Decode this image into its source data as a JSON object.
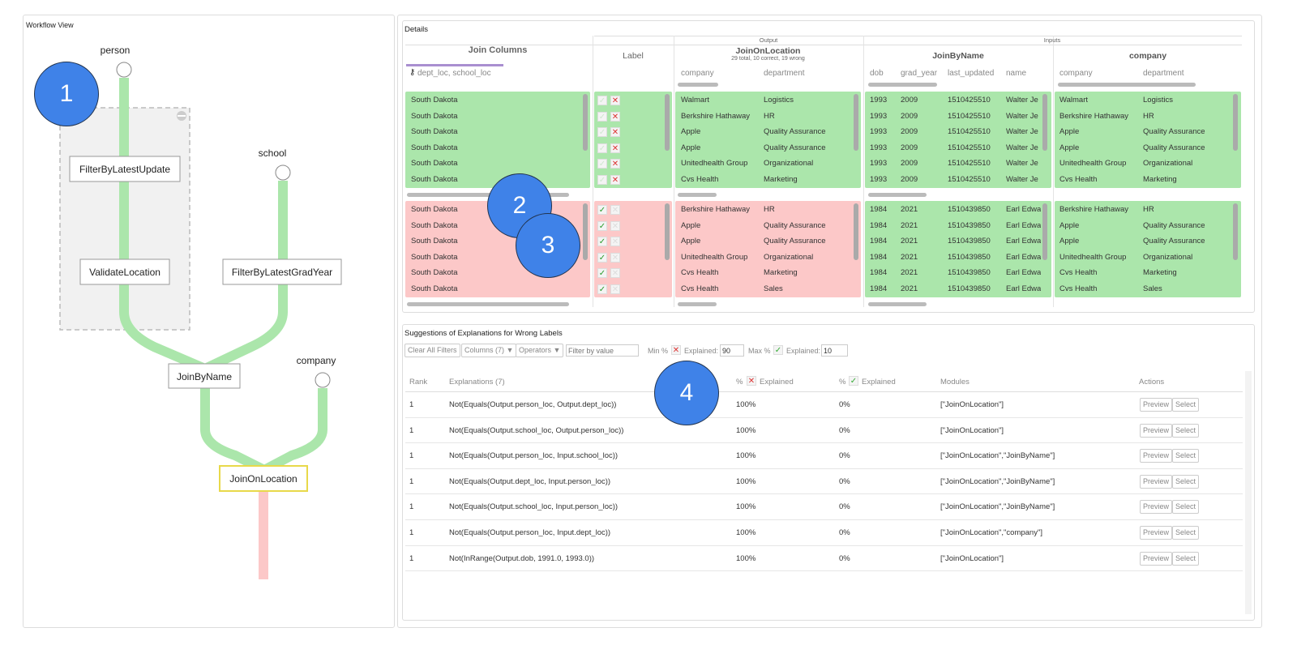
{
  "workflow": {
    "title": "Workflow View",
    "sources": [
      "person",
      "school",
      "company"
    ],
    "nodes": [
      "FilterByLatestUpdate",
      "ValidateLocation",
      "FilterByLatestGradYear",
      "JoinByName",
      "JoinOnLocation"
    ],
    "edge_colors": {
      "correct": "#abe6ab",
      "wrong": "#fcc8c8"
    },
    "selected_node_border": "#e8d94a"
  },
  "annotations": [
    "1",
    "2",
    "3",
    "4"
  ],
  "details": {
    "title": "Details",
    "join_columns": {
      "header": "Join Columns",
      "key_icon": "key-icon",
      "value": "dept_loc, school_loc"
    },
    "label": {
      "header": "Label"
    },
    "output_group": "Output",
    "inputs_group": "Inputs",
    "output": {
      "name": "JoinOnLocation",
      "summary": "29 total, 10 correct, 19 wrong",
      "columns": [
        "company",
        "department"
      ]
    },
    "joinbyname": {
      "name": "JoinByName",
      "columns": [
        "dob",
        "grad_year",
        "last_updated",
        "name"
      ]
    },
    "company": {
      "name": "company",
      "columns": [
        "company",
        "department"
      ]
    },
    "top_rows": [
      {
        "join": "South Dakota",
        "out": [
          "Walmart",
          "Logistics"
        ],
        "jbn": [
          "1993",
          "2009",
          "1510425510",
          "Walter Je"
        ],
        "comp": [
          "Walmart",
          "Logistics"
        ]
      },
      {
        "join": "South Dakota",
        "out": [
          "Berkshire Hathaway",
          "HR"
        ],
        "jbn": [
          "1993",
          "2009",
          "1510425510",
          "Walter Je"
        ],
        "comp": [
          "Berkshire Hathaway",
          "HR"
        ]
      },
      {
        "join": "South Dakota",
        "out": [
          "Apple",
          "Quality Assurance"
        ],
        "jbn": [
          "1993",
          "2009",
          "1510425510",
          "Walter Je"
        ],
        "comp": [
          "Apple",
          "Quality Assurance"
        ]
      },
      {
        "join": "South Dakota",
        "out": [
          "Apple",
          "Quality Assurance"
        ],
        "jbn": [
          "1993",
          "2009",
          "1510425510",
          "Walter Je"
        ],
        "comp": [
          "Apple",
          "Quality Assurance"
        ]
      },
      {
        "join": "South Dakota",
        "out": [
          "Unitedhealth Group",
          "Organizational"
        ],
        "jbn": [
          "1993",
          "2009",
          "1510425510",
          "Walter Je"
        ],
        "comp": [
          "Unitedhealth Group",
          "Organizational"
        ]
      },
      {
        "join": "South Dakota",
        "out": [
          "Cvs Health",
          "Marketing"
        ],
        "jbn": [
          "1993",
          "2009",
          "1510425510",
          "Walter Je"
        ],
        "comp": [
          "Cvs Health",
          "Marketing"
        ]
      }
    ],
    "top_label": "wrong",
    "bottom_rows": [
      {
        "join": "South Dakota",
        "out": [
          "Berkshire Hathaway",
          "HR"
        ],
        "jbn": [
          "1984",
          "2021",
          "1510439850",
          "Earl Edwa"
        ],
        "comp": [
          "Berkshire Hathaway",
          "HR"
        ]
      },
      {
        "join": "South Dakota",
        "out": [
          "Apple",
          "Quality Assurance"
        ],
        "jbn": [
          "1984",
          "2021",
          "1510439850",
          "Earl Edwa"
        ],
        "comp": [
          "Apple",
          "Quality Assurance"
        ]
      },
      {
        "join": "South Dakota",
        "out": [
          "Apple",
          "Quality Assurance"
        ],
        "jbn": [
          "1984",
          "2021",
          "1510439850",
          "Earl Edwa"
        ],
        "comp": [
          "Apple",
          "Quality Assurance"
        ]
      },
      {
        "join": "South Dakota",
        "out": [
          "Unitedhealth Group",
          "Organizational"
        ],
        "jbn": [
          "1984",
          "2021",
          "1510439850",
          "Earl Edwa"
        ],
        "comp": [
          "Unitedhealth Group",
          "Organizational"
        ]
      },
      {
        "join": "South Dakota",
        "out": [
          "Cvs Health",
          "Marketing"
        ],
        "jbn": [
          "1984",
          "2021",
          "1510439850",
          "Earl Edwa"
        ],
        "comp": [
          "Cvs Health",
          "Marketing"
        ]
      },
      {
        "join": "South Dakota",
        "out": [
          "Cvs Health",
          "Sales"
        ],
        "jbn": [
          "1984",
          "2021",
          "1510439850",
          "Earl Edwa"
        ],
        "comp": [
          "Cvs Health",
          "Sales"
        ]
      }
    ],
    "bottom_label": "correct"
  },
  "suggestions": {
    "title": "Suggestions of Explanations for Wrong Labels",
    "toolbar": {
      "clear": "Clear All Filters",
      "columns": "Columns (7) ▼",
      "operators": "Operators ▼",
      "filter_placeholder": "Filter by value",
      "min_label_pre": "Min %",
      "min_label_post": "Explained:",
      "min_value": "90",
      "max_label_pre": "Max %",
      "max_label_post": "Explained:",
      "max_value": "10"
    },
    "headers": {
      "rank": "Rank",
      "explanations": "Explanations (7)",
      "wrong_pre": "%",
      "wrong_post": "Explained",
      "correct_pre": "%",
      "correct_post": "Explained",
      "modules": "Modules",
      "actions": "Actions"
    },
    "preview_label": "Preview",
    "select_label": "Select",
    "rows": [
      {
        "rank": "1",
        "exp": "Not(Equals(Output.person_loc, Output.dept_loc))",
        "wrong": "100%",
        "correct": "0%",
        "modules": "[\"JoinOnLocation\"]"
      },
      {
        "rank": "1",
        "exp": "Not(Equals(Output.school_loc, Output.person_loc))",
        "wrong": "100%",
        "correct": "0%",
        "modules": "[\"JoinOnLocation\"]"
      },
      {
        "rank": "1",
        "exp": "Not(Equals(Output.person_loc, Input.school_loc))",
        "wrong": "100%",
        "correct": "0%",
        "modules": "[\"JoinOnLocation\",\"JoinByName\"]"
      },
      {
        "rank": "1",
        "exp": "Not(Equals(Output.dept_loc, Input.person_loc))",
        "wrong": "100%",
        "correct": "0%",
        "modules": "[\"JoinOnLocation\",\"JoinByName\"]"
      },
      {
        "rank": "1",
        "exp": "Not(Equals(Output.school_loc, Input.person_loc))",
        "wrong": "100%",
        "correct": "0%",
        "modules": "[\"JoinOnLocation\",\"JoinByName\"]"
      },
      {
        "rank": "1",
        "exp": "Not(Equals(Output.person_loc, Input.dept_loc))",
        "wrong": "100%",
        "correct": "0%",
        "modules": "[\"JoinOnLocation\",\"company\"]"
      },
      {
        "rank": "1",
        "exp": "Not(InRange(Output.dob, 1991.0, 1993.0))",
        "wrong": "100%",
        "correct": "0%",
        "modules": "[\"JoinOnLocation\"]"
      }
    ]
  }
}
